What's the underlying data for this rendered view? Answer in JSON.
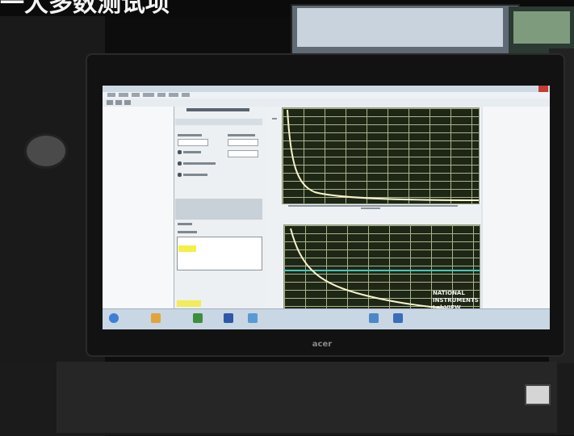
{
  "caption": {
    "text": "一大多数测试项"
  },
  "brand": {
    "logo_text": "acer"
  },
  "app": {
    "ni_logo": {
      "line1": "NATIONAL",
      "line2": "INSTRUMENTS",
      "line3": "LabVIEW"
    }
  },
  "chart_data": [
    {
      "type": "line",
      "series": [
        {
          "shape": "decay"
        }
      ],
      "grid": true
    },
    {
      "type": "line",
      "series": [
        {
          "shape": "decay"
        },
        {
          "shape": "flat"
        }
      ],
      "grid": true
    }
  ],
  "colors": {
    "plot_bg": "#1e2716",
    "curve": "#f6f3c9",
    "reference_line": "#42c8c2",
    "highlight": "#f4f047"
  },
  "icons": [
    "start-orb-icon",
    "folder-icon",
    "browser-icon",
    "labview-icon",
    "network-icon",
    "speaker-icon",
    "clock-icon"
  ]
}
